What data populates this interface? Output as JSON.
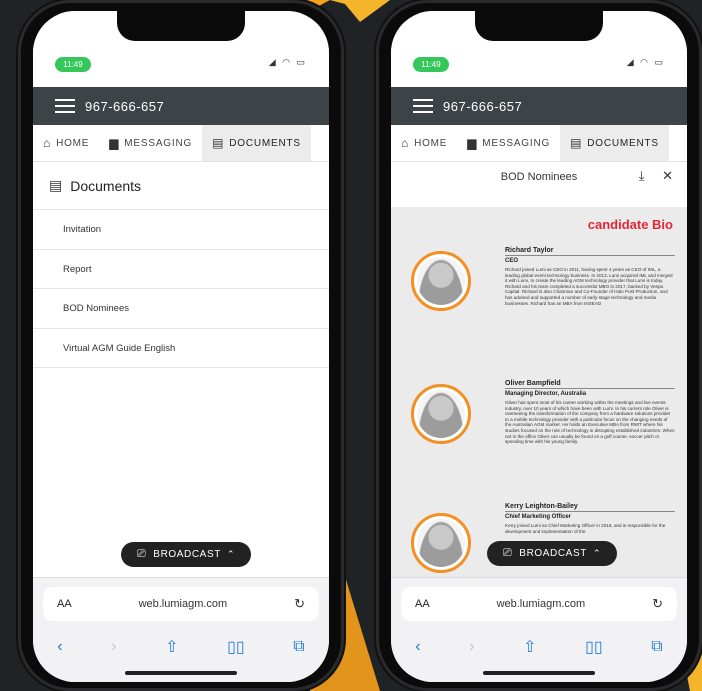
{
  "left_phone": {
    "status": {
      "time": "11:49",
      "icons": "◢ ◠ ▭"
    },
    "topbar": {
      "phone_number": "967-666-657"
    },
    "tabs": [
      {
        "label": "HOME",
        "icon": "home-icon"
      },
      {
        "label": "MESSAGING",
        "icon": "message-icon"
      },
      {
        "label": "DOCUMENTS",
        "icon": "document-icon",
        "active": true
      }
    ],
    "documents": {
      "title": "Documents",
      "items": [
        "Invitation",
        "Report",
        "BOD Nominees",
        "Virtual AGM Guide English"
      ]
    },
    "broadcast": {
      "label": "BROADCAST"
    },
    "safari": {
      "aa": "AA",
      "url": "web.lumiagm.com"
    }
  },
  "right_phone": {
    "status": {
      "time": "11:49",
      "icons": "◢ ◠ ▭"
    },
    "topbar": {
      "phone_number": "967-666-657"
    },
    "tabs": [
      {
        "label": "HOME",
        "icon": "home-icon"
      },
      {
        "label": "MESSAGING",
        "icon": "message-icon"
      },
      {
        "label": "DOCUMENTS",
        "icon": "document-icon",
        "active": true
      }
    ],
    "viewer": {
      "title": "BOD Nominees"
    },
    "bio_page": {
      "heading": "candidate Bio",
      "people": [
        {
          "name": "Richard Taylor",
          "role": "CEO",
          "body": "Richard joined Lumi as CEO in 2011, having spent 4 years as CEO of IML, a leading global event technology business. In 2013, Lumi acquired IML and merged it with Lumi, to create the leading AGM technology provider that Lumi is today. Richard and his team completed a successful MBO in 2017, backed by Vespa Capital. Richard is also Chairman and Co-Founder of Halo Post Production, and has advised and supported a number of early-stage technology and media businesses. Richard has an MBA from INSEAD"
        },
        {
          "name": "Oliver Bampfield",
          "role": "Managing Director, Australia",
          "body": "Oliver has spent most of his career working within the meetings and live events industry, over 10 years of which have been with Lumi. In his current role Oliver is overseeing the transformation of the company from a hardware solutions provider to a mobile technology provider with a particular focus on the changing needs of the Australian AGM market. He holds an Executive MBA from RMIT where his studies focused on the role of technology in disrupting established industries. When not in the office Oliver can usually be found on a golf course, soccer pitch or spending time with his young family."
        },
        {
          "name": "Kerry Leighton-Bailey",
          "role": "Chief Marketing Officer",
          "body": "Kerry joined Lumi as Chief Marketing Officer in 2018, and is responsible for the development and implementation of the"
        }
      ]
    },
    "broadcast": {
      "label": "BROADCAST"
    },
    "safari": {
      "aa": "AA",
      "url": "web.lumiagm.com"
    }
  },
  "colors": {
    "accent_orange": "#f29021",
    "bio_red": "#e32636",
    "topbar": "#3d4448",
    "safari_blue": "#1f7ae0"
  }
}
